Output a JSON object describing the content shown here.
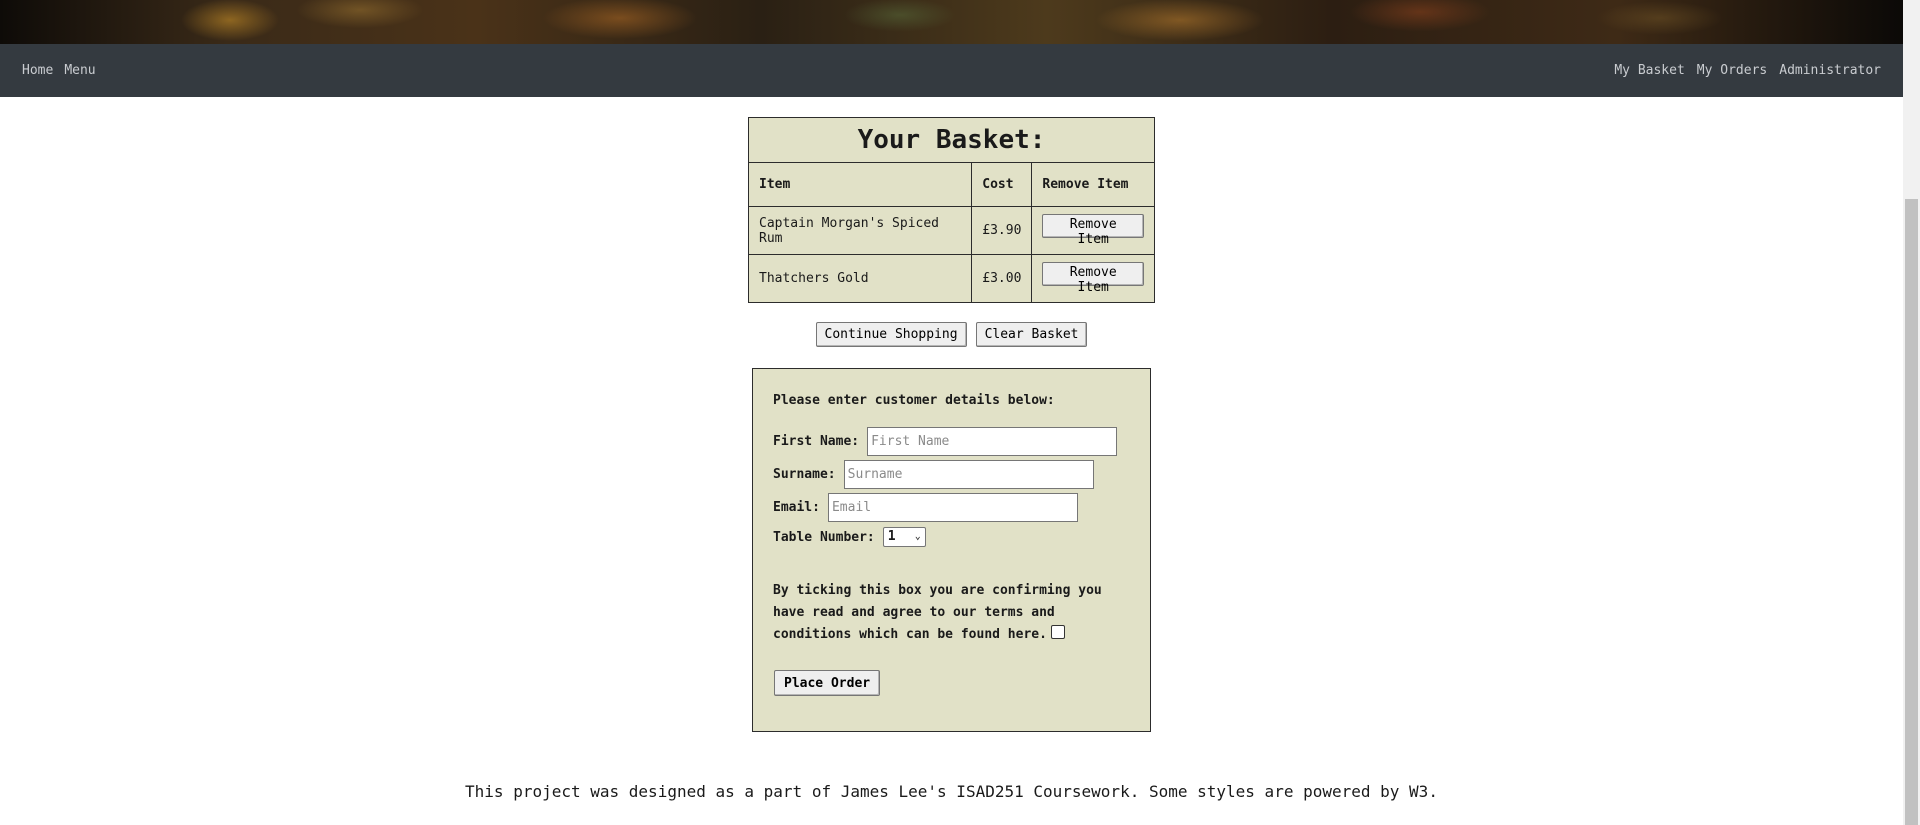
{
  "nav": {
    "left": [
      {
        "label": "Home"
      },
      {
        "label": "Menu"
      }
    ],
    "right": [
      {
        "label": "My Basket"
      },
      {
        "label": "My Orders"
      },
      {
        "label": "Administrator"
      }
    ]
  },
  "basket": {
    "title": "Your Basket:",
    "columns": [
      "Item",
      "Cost",
      "Remove Item"
    ],
    "rows": [
      {
        "item": "Captain Morgan's Spiced Rum",
        "cost": "£3.90",
        "action": "Remove Item"
      },
      {
        "item": "Thatchers Gold",
        "cost": "£3.00",
        "action": "Remove Item"
      }
    ],
    "continue_label": "Continue Shopping",
    "clear_label": "Clear Basket"
  },
  "form": {
    "heading": "Please enter customer details below:",
    "first_name_label": "First Name:",
    "first_name_placeholder": "First Name",
    "surname_label": "Surname:",
    "surname_placeholder": "Surname",
    "email_label": "Email:",
    "email_placeholder": "Email",
    "table_label": "Table Number:",
    "table_value": "1",
    "terms_text": "By ticking this box you are confirming you have read and agree to our terms and conditions which can be found here.",
    "terms_checked": false,
    "submit_label": "Place Order"
  },
  "footer": {
    "text": "This project was designed as a part of James Lee's ISAD251 Coursework. Some styles are powered by W3."
  }
}
